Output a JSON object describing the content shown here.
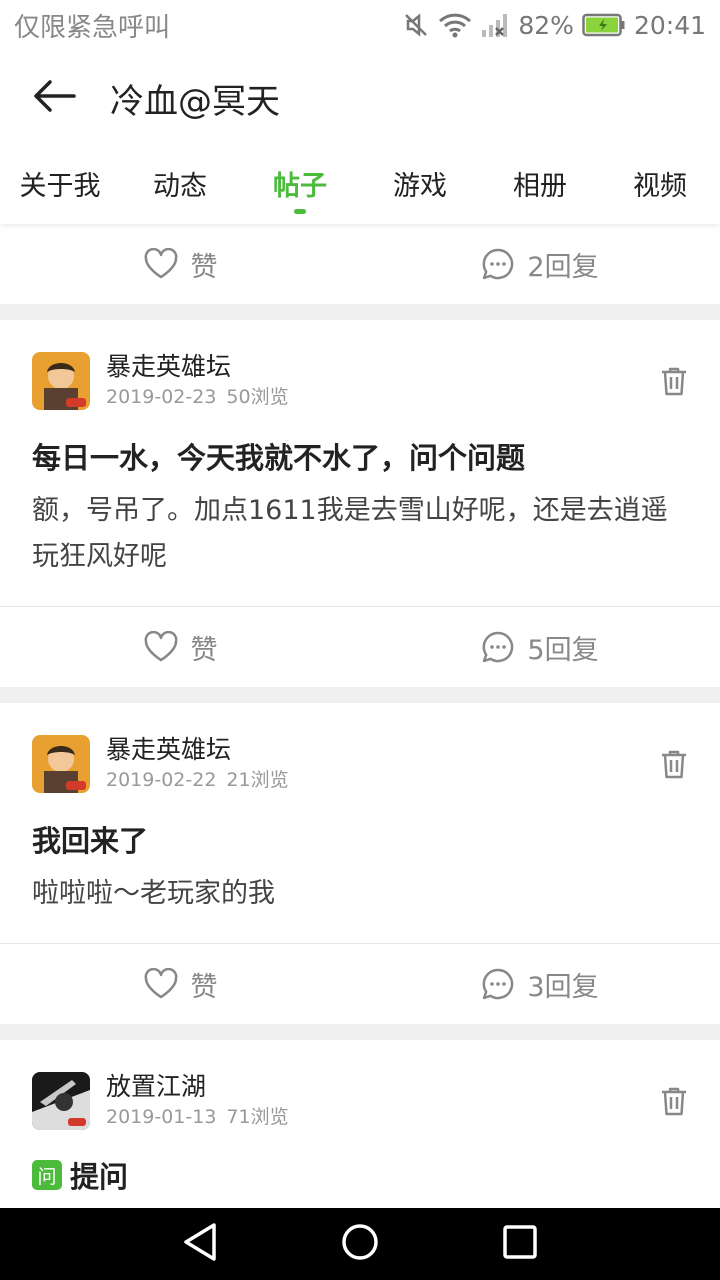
{
  "status_bar": {
    "carrier": "仅限紧急呼叫",
    "battery": "82%",
    "time": "20:41",
    "icons": [
      "mute-icon",
      "wifi-icon",
      "signal-icon",
      "battery-icon"
    ]
  },
  "header": {
    "title": "冷血@冥天",
    "back_icon": "back-arrow-icon"
  },
  "tabs": [
    {
      "label": "关于我"
    },
    {
      "label": "动态"
    },
    {
      "label": "帖子",
      "active": true
    },
    {
      "label": "游戏"
    },
    {
      "label": "相册"
    },
    {
      "label": "视频"
    }
  ],
  "top_actions": {
    "like": "赞",
    "reply": "2回复"
  },
  "posts": [
    {
      "game": "暴走英雄坛",
      "date": "2019-02-23",
      "views": "50浏览",
      "title": "每日一水，今天我就不水了，问个问题",
      "body": "额，号吊了。加点1611我是去雪山好呢，还是去逍遥玩狂风好呢",
      "like": "赞",
      "reply": "5回复"
    },
    {
      "game": "暴走英雄坛",
      "date": "2019-02-22",
      "views": "21浏览",
      "title": "我回来了",
      "body": "啦啦啦～老玩家的我",
      "like": "赞",
      "reply": "3回复"
    },
    {
      "game": "放置江湖",
      "date": "2019-01-13",
      "views": "71浏览",
      "badge": "问",
      "title": "提问"
    }
  ],
  "colors": {
    "accent": "#4cbb3c",
    "battery": "#8bd33a"
  }
}
